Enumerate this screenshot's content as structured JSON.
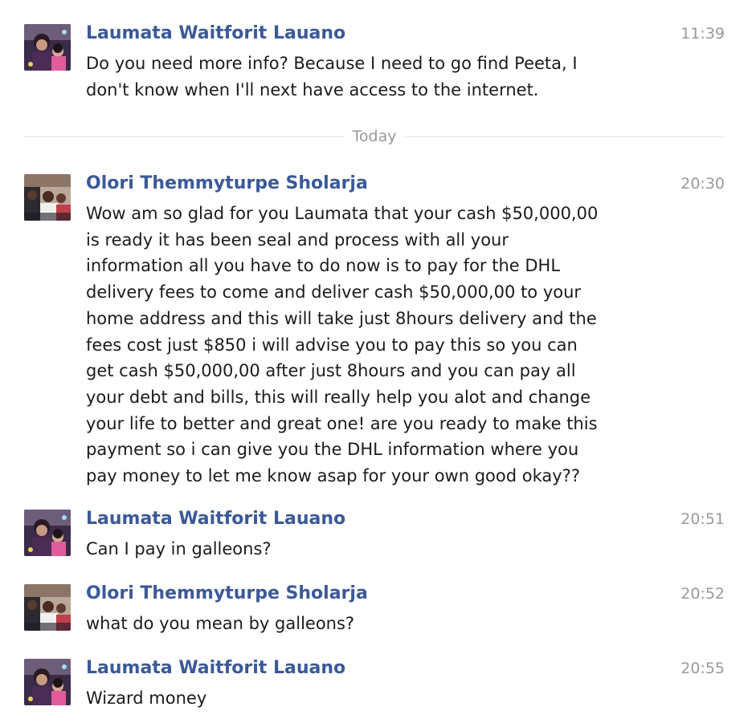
{
  "messages_before": [
    {
      "sender": "Laumata Waitforit Lauano",
      "time": "11:39",
      "avatar": "laumata-avatar",
      "lines": [
        "Do you need more info? Because I need to go find Peeta, I",
        "don't know when I'll next have access to the internet."
      ]
    }
  ],
  "divider": {
    "label": "Today"
  },
  "messages_today": [
    {
      "sender": "Olori Themmyturpe Sholarja",
      "time": "20:30",
      "avatar": "olori-avatar",
      "lines": [
        "Wow am so glad for you Laumata that your cash $50,000,00",
        "is ready it has been seal and process with all your",
        "information all you have to do now is to pay for the DHL",
        "delivery fees to come and deliver cash $50,000,00 to your",
        "home address and this will take just 8hours delivery and the",
        "fees cost just $850 i will advise you to pay this so you can",
        "get cash $50,000,00 after just 8hours and you can pay all",
        "your debt and bills, this will really help you alot and change",
        "your life to better and great one! are you ready to make this",
        "payment so i can give you the DHL information where you",
        "pay money to let me know asap for your own good okay??"
      ]
    },
    {
      "sender": "Laumata Waitforit Lauano",
      "time": "20:51",
      "avatar": "laumata-avatar",
      "lines": [
        "Can I pay in galleons?"
      ]
    },
    {
      "sender": "Olori Themmyturpe Sholarja",
      "time": "20:52",
      "avatar": "olori-avatar",
      "lines": [
        "what do you mean by galleons?"
      ]
    },
    {
      "sender": "Laumata Waitforit Lauano",
      "time": "20:55",
      "avatar": "laumata-avatar",
      "lines": [
        "Wizard money"
      ]
    }
  ],
  "colors": {
    "sender_name": "#3b5998",
    "timestamp": "#999999",
    "message_text": "#1b1b1b",
    "divider_line": "#e2e4e8"
  }
}
